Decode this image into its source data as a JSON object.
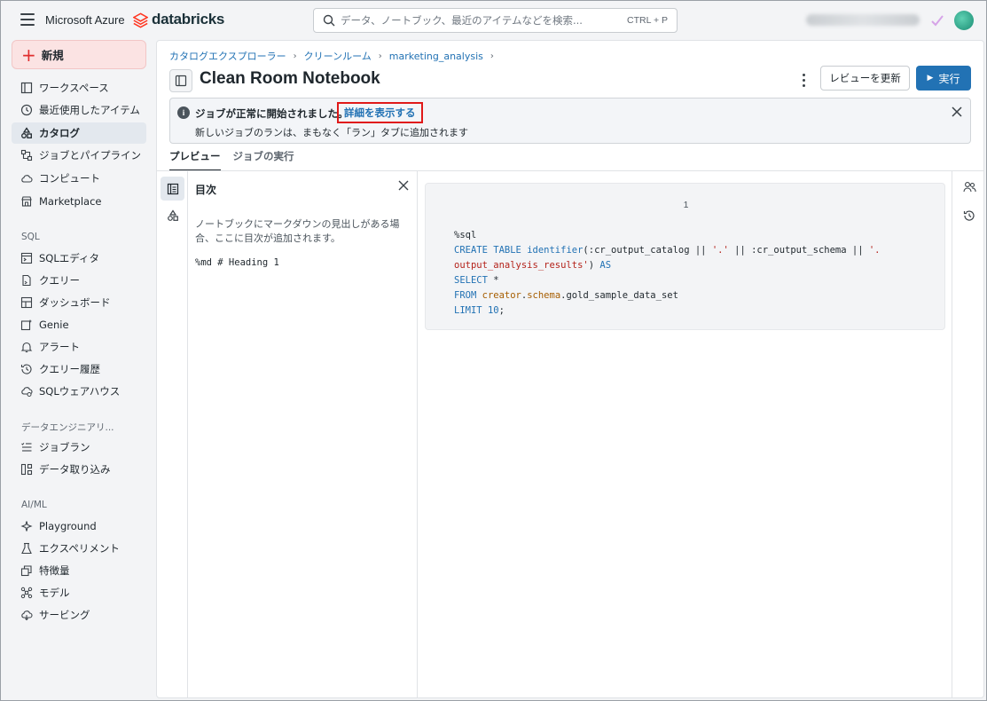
{
  "topbar": {
    "brand": "Microsoft Azure",
    "product": "databricks",
    "search_placeholder": "データ、ノートブック、最近のアイテムなどを検索...",
    "search_shortcut": "CTRL + P",
    "brand_color": "#ff3621"
  },
  "sidebar": {
    "new_label": "新規",
    "items": [
      {
        "label": "ワークスペース",
        "icon": "workspace-icon"
      },
      {
        "label": "最近使用したアイテム",
        "icon": "clock-icon"
      },
      {
        "label": "カタログ",
        "icon": "catalog-icon",
        "active": true
      },
      {
        "label": "ジョブとパイプライン",
        "icon": "workflow-icon"
      },
      {
        "label": "コンピュート",
        "icon": "cloud-icon"
      },
      {
        "label": "Marketplace",
        "icon": "store-icon"
      }
    ],
    "sql_section": "SQL",
    "sql_items": [
      {
        "label": "SQLエディタ",
        "icon": "editor-icon"
      },
      {
        "label": "クエリー",
        "icon": "query-icon"
      },
      {
        "label": "ダッシュボード",
        "icon": "dashboard-icon"
      },
      {
        "label": "Genie",
        "icon": "genie-icon"
      },
      {
        "label": "アラート",
        "icon": "bell-icon"
      },
      {
        "label": "クエリー履歴",
        "icon": "history-icon"
      },
      {
        "label": "SQLウェアハウス",
        "icon": "warehouse-icon"
      }
    ],
    "de_section": "データエンジニアリ...",
    "de_items": [
      {
        "label": "ジョブラン",
        "icon": "list-icon"
      },
      {
        "label": "データ取り込み",
        "icon": "ingest-icon"
      }
    ],
    "ml_section": "AI/ML",
    "ml_items": [
      {
        "label": "Playground",
        "icon": "sparkle-icon"
      },
      {
        "label": "エクスペリメント",
        "icon": "flask-icon"
      },
      {
        "label": "特徴量",
        "icon": "feature-icon"
      },
      {
        "label": "モデル",
        "icon": "model-icon"
      },
      {
        "label": "サービング",
        "icon": "serving-icon"
      }
    ]
  },
  "breadcrumb": [
    "カタログエクスプローラー",
    "クリーンルーム",
    "marketing_analysis"
  ],
  "page": {
    "title": "Clean Room Notebook",
    "review_button": "レビューを更新",
    "run_button": "実行"
  },
  "banner": {
    "message": "ジョブが正常に開始されました。",
    "link": "詳細を表示する",
    "sub": "新しいジョブのランは、まもなく「ラン」タブに追加されます"
  },
  "tabs": [
    "プレビュー",
    "ジョブの実行"
  ],
  "toc": {
    "title": "目次",
    "empty_text": "ノートブックにマークダウンの見出しがある場合、ここに目次が追加されます。",
    "heading_code": "%md # Heading 1"
  },
  "cell": {
    "number": "1",
    "lines": [
      "%sql",
      "CREATE TABLE identifier(:cr_output_catalog || '.' || :cr_output_schema || '.",
      "output_analysis_results') AS",
      "SELECT *",
      "FROM creator.schema.gold_sample_data_set",
      "LIMIT 10;"
    ]
  }
}
